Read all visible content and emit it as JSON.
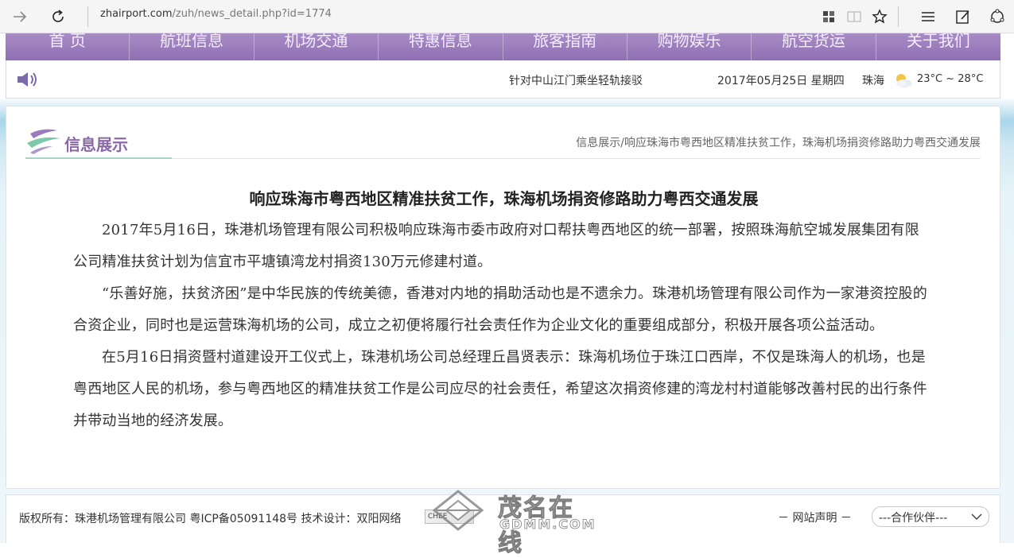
{
  "browser": {
    "url_host": "zhairport.com",
    "url_path": "/zuh/news_detail.php?id=1774"
  },
  "nav": {
    "items": [
      "首 页",
      "航班信息",
      "机场交通",
      "特惠信息",
      "旅客指南",
      "购物娱乐",
      "航空货运",
      "关于我们"
    ]
  },
  "infobar": {
    "ticker": "针对中山江门乘坐轻轨接驳",
    "date": "2017年05月25日  星期四",
    "city": "珠海",
    "temperature": "23°C ~ 28°C"
  },
  "section": {
    "title": "信息展示",
    "breadcrumb": "信息展示/响应珠海市粤西地区精准扶贫工作，珠海机场捐资修路助力粤西交通发展"
  },
  "article": {
    "title": "响应珠海市粤西地区精准扶贫工作，珠海机场捐资修路助力粤西交通发展",
    "paragraphs": [
      "2017年5月16日，珠港机场管理有限公司积极响应珠海市委市政府对口帮扶粤西地区的统一部署，按照珠海航空城发展集团有限公司精准扶贫计划为信宜市平塘镇湾龙村捐资130万元修建村道。",
      "“乐善好施，扶贫济困”是中华民族的传统美德，香港对内地的捐助活动也是不遗余力。珠港机场管理有限公司作为一家港资控股的合资企业，同时也是运营珠海机场的公司，成立之初便将履行社会责任作为企业文化的重要组成部分，积极开展各项公益活动。",
      "在5月16日捐资暨村道建设开工仪式上，珠港机场公司总经理丘昌贤表示：珠海机场位于珠江口西岸，不仅是珠海人的机场，也是粤西地区人民的机场，参与粤西地区的精准扶贫工作是公司应尽的社会责任，希望这次捐资修建的湾龙村村道能够改善村民的出行条件并带动当地的经济发展。"
    ]
  },
  "footer": {
    "copyright": "版权所有：珠港机场管理有限公司  粤ICP备05091148号  技术设计：双阳网络",
    "mini_logo": "CHEE",
    "declare": "－ 网站声明 －",
    "partner_select": "---合作伙伴---"
  },
  "watermark": {
    "text": "茂名在线",
    "sub": "GDMM.COM"
  },
  "colors": {
    "nav": "#9a7cbc",
    "section_title": "#8a6aa6"
  }
}
